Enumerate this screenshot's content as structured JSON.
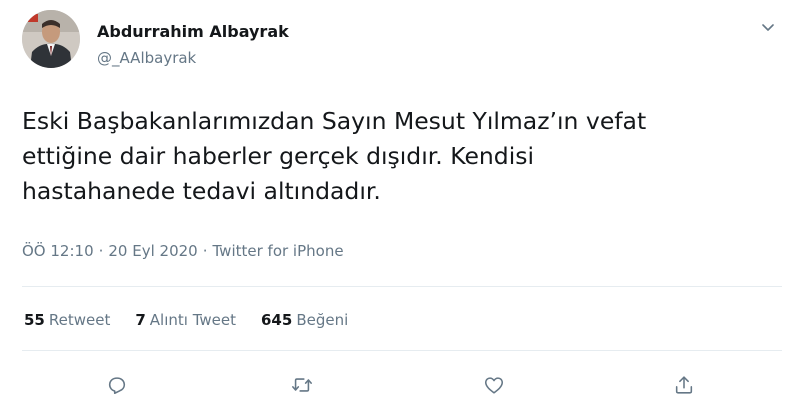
{
  "author": {
    "name": "Abdurrahim Albayrak",
    "handle": "@_AAlbayrak"
  },
  "tweet": {
    "lines": [
      "Eski Başbakanlarımızdan Sayın Mesut Yılmaz’ın vefat",
      "ettiğine dair haberler gerçek dışıdır. Kendisi",
      "hastahanede tedavi altındadır."
    ]
  },
  "meta": {
    "time": "ÖÖ 12:10",
    "separator": "·",
    "date": "20 Eyl 2020",
    "source": "Twitter for iPhone"
  },
  "stats": {
    "retweets": {
      "count": "55",
      "label": "Retweet"
    },
    "quotes": {
      "count": "7",
      "label": "Alıntı Tweet"
    },
    "likes": {
      "count": "645",
      "label": "Beğeni"
    }
  },
  "icons": {
    "more": "chevron-down-icon",
    "reply": "reply-icon",
    "retweet": "retweet-icon",
    "like": "heart-icon",
    "share": "share-icon"
  },
  "colors": {
    "text": "#14171a",
    "secondary": "#657786",
    "divider": "#e6ecf0"
  }
}
